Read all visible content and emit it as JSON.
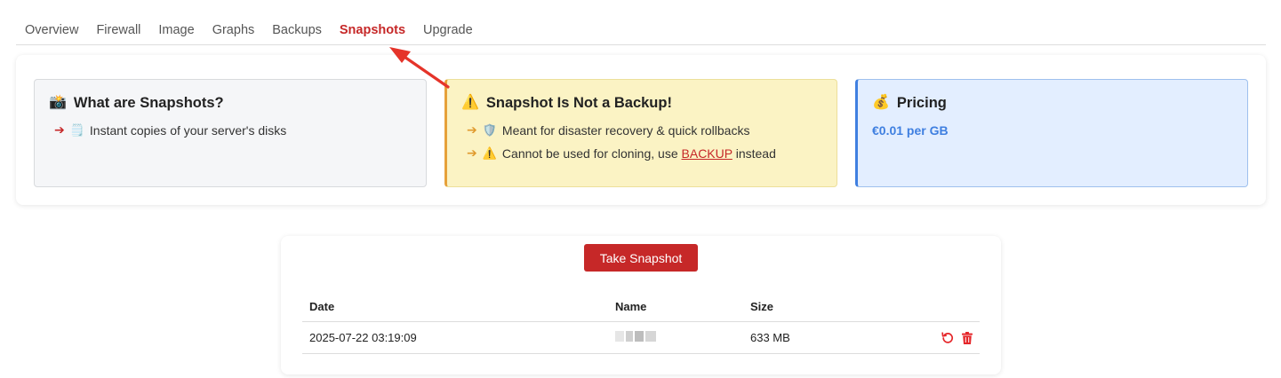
{
  "tabs": [
    "Overview",
    "Firewall",
    "Image",
    "Graphs",
    "Backups",
    "Snapshots",
    "Upgrade"
  ],
  "active_tab": "Snapshots",
  "cards": {
    "what": {
      "title": "What are Snapshots?",
      "emoji": "📸",
      "lines": [
        {
          "arrow": "➔",
          "emoji": "🗒️",
          "text": "Instant copies of your server's disks"
        }
      ]
    },
    "warning": {
      "title": "Snapshot Is Not a Backup!",
      "emoji": "⚠️",
      "line1": {
        "arrow": "➔",
        "emoji": "🛡️",
        "text": "Meant for disaster recovery & quick rollbacks"
      },
      "line2": {
        "arrow": "➔",
        "emoji": "⚠️",
        "text_before": "Cannot be used for cloning, use",
        "link": "BACKUP",
        "text_after": "instead"
      }
    },
    "pricing": {
      "title": "Pricing",
      "emoji": "💰",
      "price": "€0.01 per GB"
    }
  },
  "snapshots": {
    "take_button": "Take Snapshot",
    "columns": {
      "date": "Date",
      "name": "Name",
      "size": "Size"
    },
    "rows": [
      {
        "date": "2025-07-22 03:19:09",
        "name": "",
        "size": "633 MB"
      }
    ]
  },
  "colors": {
    "accent_red": "#c62828",
    "warn_border": "#e6a13a",
    "info_blue": "#3f7fe0"
  },
  "icons": {
    "restore": "restore-icon",
    "delete": "trash-icon"
  }
}
